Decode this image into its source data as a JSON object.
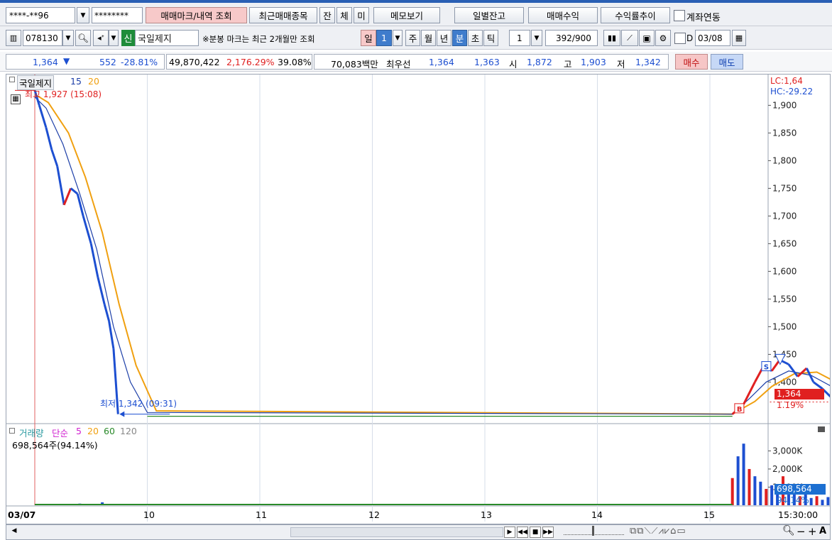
{
  "toolbar1": {
    "account_number": "****-**96",
    "account_dropdown": "▼",
    "password": "********",
    "btn_trade_mark": "매매마크/내역 조회",
    "btn_recent": "최근매매종목",
    "btn_jan": "잔",
    "btn_che": "체",
    "btn_mi": "미",
    "btn_memo": "메모보기",
    "btn_daily_balance": "일별잔고",
    "btn_trade_profit": "매매수익",
    "btn_return_trend": "수익률추이",
    "link_account_label": "계좌연동"
  },
  "toolbar2": {
    "stock_code": "078130",
    "stock_badge": "신",
    "stock_name": "국일제지",
    "notice": "※분봉 마크는 최근 2개월만 조회",
    "period_il": "일",
    "period_num": "1",
    "period_ju": "주",
    "period_wol": "월",
    "period_nyeon": "년",
    "period_bun": "분",
    "period_cho": "초",
    "period_tik": "틱",
    "interval_value": "1",
    "count_display": "392",
    "count_max": "/900",
    "date_prefix": "D",
    "date_value": "03/08"
  },
  "quote": {
    "price": "1,364",
    "price_arrow": "▼",
    "change": "552",
    "change_pct": "-28.81%",
    "volume": "49,870,422",
    "volume_pct": "2,176.29%",
    "turnover": "39.08%",
    "amount": "70,083백만",
    "best_label": "최우선",
    "best_ask": "1,364",
    "best_bid": "1,363",
    "open_label": "시",
    "open": "1,872",
    "high_label": "고",
    "high": "1,903",
    "low_label": "저",
    "low": "1,342",
    "btn_buy": "매수",
    "btn_sell": "매도"
  },
  "price_panel": {
    "stock_name": "국일제지",
    "ma1": "15",
    "ma2": "20",
    "high_label": "최고 1,927 (15:08)",
    "low_label": "최저 1,342 (09:31)",
    "lc_label": "LC:1,64",
    "hc_label": "HC:-29.22",
    "current_price_tag": "1,364",
    "current_pct_tag": "1.19%",
    "y_ticks": [
      "1,900",
      "1,850",
      "1,800",
      "1,750",
      "1,700",
      "1,650",
      "1,600",
      "1,550",
      "1,500",
      "1,450",
      "1,400"
    ]
  },
  "volume_panel": {
    "title": "거래량",
    "ma_label": "단순",
    "ma_values": [
      "5",
      "20",
      "60",
      "120"
    ],
    "current_volume": "698,564주(94.14%)",
    "y_ticks": [
      "3,000K",
      "2,000K",
      "1,000K"
    ],
    "current_tag": "698,564",
    "current_pct": "94.14%"
  },
  "x_axis": {
    "labels": [
      "03/07",
      "10",
      "11",
      "12",
      "13",
      "14",
      "15"
    ],
    "time_label": "15:30:00"
  },
  "colors": {
    "up": "#e02020",
    "down": "#1d4fd1",
    "ma15": "#1d3fa8",
    "ma20": "#f0a010",
    "ma60": "#2a8a2a",
    "grid": "#d6dde8"
  },
  "chart_data": {
    "type": "line",
    "price_ylim": [
      1330,
      1930
    ],
    "price_series": [
      {
        "x": 0.0,
        "y": 1927
      },
      {
        "x": 0.04,
        "y": 1900
      },
      {
        "x": 0.1,
        "y": 1860
      },
      {
        "x": 0.15,
        "y": 1820
      },
      {
        "x": 0.2,
        "y": 1790
      },
      {
        "x": 0.26,
        "y": 1720
      },
      {
        "x": 0.32,
        "y": 1750
      },
      {
        "x": 0.38,
        "y": 1740
      },
      {
        "x": 0.43,
        "y": 1700
      },
      {
        "x": 0.5,
        "y": 1650
      },
      {
        "x": 0.56,
        "y": 1590
      },
      {
        "x": 0.62,
        "y": 1540
      },
      {
        "x": 0.66,
        "y": 1510
      },
      {
        "x": 0.7,
        "y": 1460
      },
      {
        "x": 0.74,
        "y": 1342
      },
      {
        "x": 6.2,
        "y": 1342
      },
      {
        "x": 6.3,
        "y": 1360
      },
      {
        "x": 6.4,
        "y": 1400
      },
      {
        "x": 6.48,
        "y": 1430
      },
      {
        "x": 6.55,
        "y": 1420
      },
      {
        "x": 6.62,
        "y": 1440
      },
      {
        "x": 6.7,
        "y": 1432
      },
      {
        "x": 6.78,
        "y": 1410
      },
      {
        "x": 6.86,
        "y": 1425
      },
      {
        "x": 6.92,
        "y": 1400
      },
      {
        "x": 7.0,
        "y": 1388
      },
      {
        "x": 7.08,
        "y": 1372
      },
      {
        "x": 7.16,
        "y": 1380
      },
      {
        "x": 7.24,
        "y": 1364
      }
    ],
    "ma15_series": [
      {
        "x": 0.0,
        "y": 1915
      },
      {
        "x": 0.1,
        "y": 1895
      },
      {
        "x": 0.25,
        "y": 1830
      },
      {
        "x": 0.4,
        "y": 1740
      },
      {
        "x": 0.55,
        "y": 1640
      },
      {
        "x": 0.7,
        "y": 1500
      },
      {
        "x": 0.85,
        "y": 1400
      },
      {
        "x": 1.0,
        "y": 1345
      },
      {
        "x": 6.2,
        "y": 1342
      },
      {
        "x": 6.35,
        "y": 1370
      },
      {
        "x": 6.5,
        "y": 1400
      },
      {
        "x": 6.7,
        "y": 1420
      },
      {
        "x": 6.9,
        "y": 1412
      },
      {
        "x": 7.1,
        "y": 1390
      },
      {
        "x": 7.24,
        "y": 1372
      }
    ],
    "ma20_series": [
      {
        "x": 0.0,
        "y": 1920
      },
      {
        "x": 0.12,
        "y": 1905
      },
      {
        "x": 0.3,
        "y": 1850
      },
      {
        "x": 0.45,
        "y": 1770
      },
      {
        "x": 0.6,
        "y": 1670
      },
      {
        "x": 0.75,
        "y": 1540
      },
      {
        "x": 0.9,
        "y": 1430
      },
      {
        "x": 1.08,
        "y": 1348
      },
      {
        "x": 6.2,
        "y": 1342
      },
      {
        "x": 6.4,
        "y": 1365
      },
      {
        "x": 6.55,
        "y": 1392
      },
      {
        "x": 6.75,
        "y": 1415
      },
      {
        "x": 6.95,
        "y": 1418
      },
      {
        "x": 7.12,
        "y": 1400
      },
      {
        "x": 7.24,
        "y": 1382
      }
    ],
    "volume_ylim": [
      0,
      3800
    ],
    "volume_bars": [
      {
        "x": 0.2,
        "v": 40
      },
      {
        "x": 0.4,
        "v": 90
      },
      {
        "x": 0.6,
        "v": 160
      },
      {
        "x": 0.8,
        "v": 70
      },
      {
        "x": 1.0,
        "v": 40
      },
      {
        "x": 1.3,
        "v": 25
      },
      {
        "x": 6.2,
        "v": 1500
      },
      {
        "x": 6.25,
        "v": 2700
      },
      {
        "x": 6.3,
        "v": 3400
      },
      {
        "x": 6.35,
        "v": 2000
      },
      {
        "x": 6.4,
        "v": 1600
      },
      {
        "x": 6.45,
        "v": 1300
      },
      {
        "x": 6.5,
        "v": 900
      },
      {
        "x": 6.55,
        "v": 1100
      },
      {
        "x": 6.6,
        "v": 800
      },
      {
        "x": 6.65,
        "v": 1600
      },
      {
        "x": 6.7,
        "v": 1000
      },
      {
        "x": 6.75,
        "v": 700
      },
      {
        "x": 6.8,
        "v": 500
      },
      {
        "x": 6.85,
        "v": 650
      },
      {
        "x": 6.9,
        "v": 400
      },
      {
        "x": 6.95,
        "v": 500
      },
      {
        "x": 7.0,
        "v": 300
      },
      {
        "x": 7.05,
        "v": 450
      },
      {
        "x": 7.1,
        "v": 350
      },
      {
        "x": 7.15,
        "v": 280
      },
      {
        "x": 7.2,
        "v": 698
      }
    ],
    "x_days": [
      "03/07",
      "10",
      "11",
      "12",
      "13",
      "14",
      "15"
    ]
  }
}
